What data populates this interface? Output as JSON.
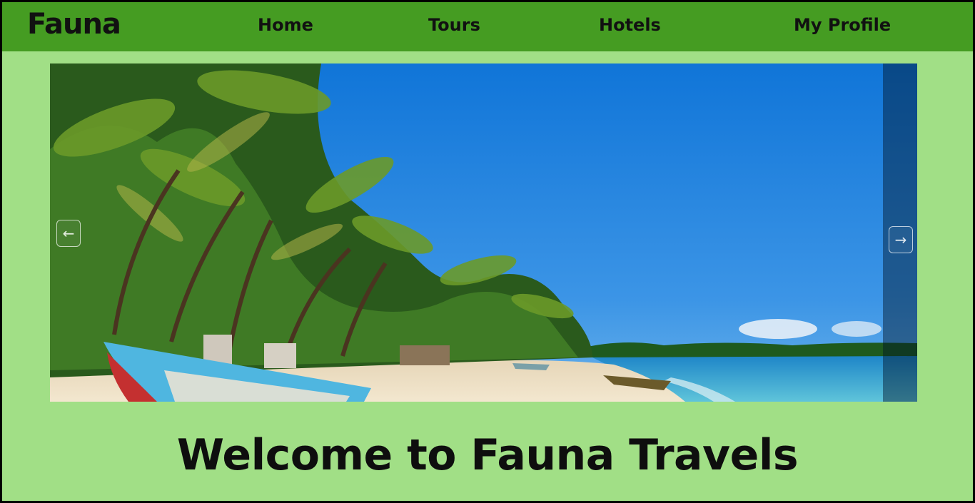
{
  "navbar": {
    "brand": "Fauna",
    "links": [
      {
        "label": "Home"
      },
      {
        "label": "Tours"
      },
      {
        "label": "Hotels"
      },
      {
        "label": "My Profile"
      }
    ]
  },
  "carousel": {
    "prev_icon": "arrow-left-icon",
    "next_icon": "arrow-right-icon",
    "prev_glyph": "←",
    "next_glyph": "→"
  },
  "hero": {
    "welcome": "Welcome to Fauna Travels"
  },
  "colors": {
    "navbar_bg": "#459c22",
    "page_bg": "#a1df86",
    "text": "#111111"
  }
}
